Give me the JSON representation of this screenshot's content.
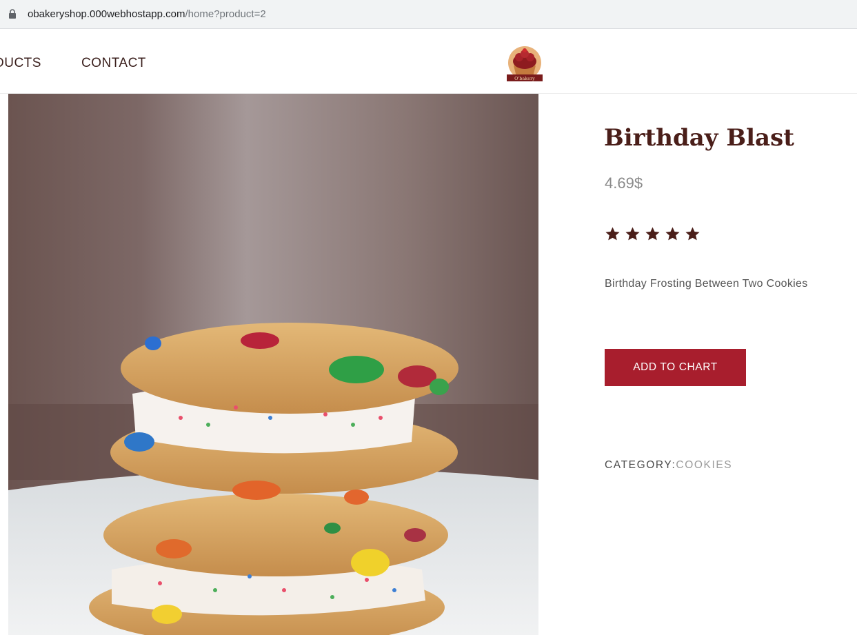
{
  "browser": {
    "url_host": "obakeryshop.000webhostapp.com",
    "url_path": "/home?product=2"
  },
  "nav": {
    "items": [
      {
        "label": "DUCTS"
      },
      {
        "label": "CONTACT"
      }
    ],
    "logo_text": "O'bakery"
  },
  "product": {
    "title": "Birthday Blast",
    "price": "4.69$",
    "rating": 5,
    "rating_max": 5,
    "description": "Birthday Frosting Between Two Cookies",
    "add_button_label": "ADD TO CHART",
    "category_label": "CATEGORY:",
    "category_value": "COOKIES"
  },
  "colors": {
    "brand_dark": "#4a1e19",
    "button_red": "#a81e2d",
    "price_gray": "#8a8a8a"
  }
}
